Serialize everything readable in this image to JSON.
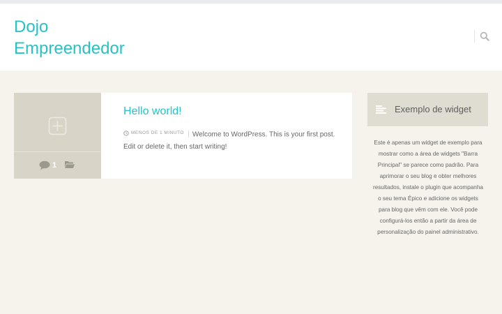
{
  "site": {
    "title_line1": "Dojo",
    "title_line2": "Empreendedor"
  },
  "header": {
    "search_icon": "search-icon"
  },
  "post": {
    "title": "Hello world!",
    "date": "Menos de 1 minuto",
    "excerpt": "Welcome to WordPress. This is your first post. Edit or delete it, then start writing!",
    "comment_count": "1",
    "icons": {
      "thumbnail": "plus-square-icon",
      "comments": "comment-icon",
      "category": "folder-open-icon",
      "date": "clock-icon"
    }
  },
  "sidebar": {
    "widget": {
      "title": "Exemplo de widget",
      "icon": "align-left-icon",
      "text": "Este é apenas um widget de exemplo para mostrar como a área de widgets \"Barra Principal\" se parece como padrão. Para aprimorar o seu blog e obter melhores resultados, instale o plugin que acompanha o seu tema Épico e adicione os widgets para blog que vêm com ele. Você pode configurá-los então a partir da área de personalização do painel administrativo."
    }
  },
  "colors": {
    "accent": "#27c2c5",
    "background": "#f6f3ec",
    "card_side": "#d8d5c8",
    "widget_header": "#dfdcd1"
  }
}
